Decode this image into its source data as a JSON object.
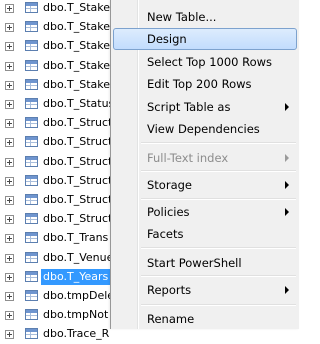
{
  "tree": {
    "nodes": [
      {
        "label": "dbo.T_Stakel",
        "selected": false
      },
      {
        "label": "dbo.T_Stakel",
        "selected": false
      },
      {
        "label": "dbo.T_Stakel",
        "selected": false
      },
      {
        "label": "dbo.T_Stakel",
        "selected": false
      },
      {
        "label": "dbo.T_Stakel",
        "selected": false
      },
      {
        "label": "dbo.T_Status",
        "selected": false
      },
      {
        "label": "dbo.T_Struct",
        "selected": false
      },
      {
        "label": "dbo.T_Struct",
        "selected": false
      },
      {
        "label": "dbo.T_Struct",
        "selected": false
      },
      {
        "label": "dbo.T_Struct",
        "selected": false
      },
      {
        "label": "dbo.T_Struct",
        "selected": false
      },
      {
        "label": "dbo.T_Struct",
        "selected": false
      },
      {
        "label": "dbo.T_Trans",
        "selected": false
      },
      {
        "label": "dbo.T_Venue",
        "selected": false
      },
      {
        "label": "dbo.T_Years",
        "selected": true
      },
      {
        "label": "dbo.tmpDele",
        "selected": false
      },
      {
        "label": "dbo.tmpNot",
        "selected": false
      },
      {
        "label": "dbo.Trace_R",
        "selected": false
      }
    ]
  },
  "context_menu": {
    "items": [
      {
        "label": "New Table...",
        "name": "menu-item-new-table"
      },
      {
        "label": "Design",
        "name": "menu-item-design",
        "highlighted": true
      },
      {
        "label": "Select Top 1000 Rows",
        "name": "menu-item-select-top-1000-rows"
      },
      {
        "label": "Edit Top 200 Rows",
        "name": "menu-item-edit-top-200-rows"
      },
      {
        "label": "Script Table as",
        "name": "menu-item-script-table-as",
        "submenu": true
      },
      {
        "label": "View Dependencies",
        "name": "menu-item-view-dependencies"
      },
      {
        "separator": true
      },
      {
        "label": "Full-Text index",
        "name": "menu-item-full-text-index",
        "submenu": true,
        "disabled": true
      },
      {
        "separator": true
      },
      {
        "label": "Storage",
        "name": "menu-item-storage",
        "submenu": true
      },
      {
        "separator": true
      },
      {
        "label": "Policies",
        "name": "menu-item-policies",
        "submenu": true
      },
      {
        "label": "Facets",
        "name": "menu-item-facets"
      },
      {
        "separator": true
      },
      {
        "label": "Start PowerShell",
        "name": "menu-item-start-powershell"
      },
      {
        "separator": true
      },
      {
        "label": "Reports",
        "name": "menu-item-reports",
        "submenu": true
      },
      {
        "separator": true
      },
      {
        "label": "Rename",
        "name": "menu-item-rename"
      }
    ]
  },
  "colors": {
    "selection": "#3399ff",
    "menu_background": "#f0f0f0",
    "menu_highlight_border": "#7da2ce"
  },
  "icons": {
    "expander": "plus-expander-icon",
    "table": "table-icon",
    "submenu": "submenu-arrow-icon"
  }
}
